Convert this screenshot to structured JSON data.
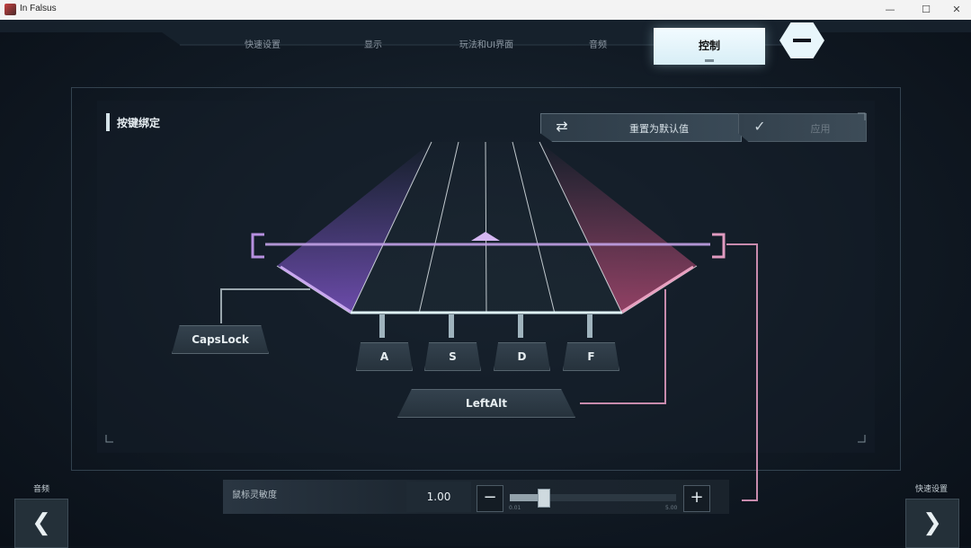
{
  "window": {
    "title": "In Falsus",
    "min": "—",
    "max": "☐",
    "close": "✕"
  },
  "tabs": [
    {
      "label": "快速设置"
    },
    {
      "label": "显示"
    },
    {
      "label": "玩法和UI界面"
    },
    {
      "label": "音频"
    },
    {
      "label": "控制",
      "active": true
    }
  ],
  "menu_button_icon": "minus-icon",
  "section": {
    "title": "按键绑定"
  },
  "actions": {
    "reset": {
      "label": "重置为默认值",
      "icon": "⇄"
    },
    "apply": {
      "label": "应用",
      "icon": "✓"
    }
  },
  "keys": {
    "left_side": "CapsLock",
    "lanes": [
      "A",
      "S",
      "D",
      "F"
    ],
    "bottom": "LeftAlt"
  },
  "sensitivity": {
    "label": "鼠标灵敏度",
    "value": "1.00",
    "min_label": "0.01",
    "max_label": "5.00",
    "level": 1.0,
    "minus": "−",
    "plus": "+"
  },
  "nav": {
    "prev": {
      "label": "音频",
      "arrow": "❮"
    },
    "next": {
      "label": "快速设置",
      "arrow": "❯"
    }
  },
  "colors": {
    "accent_purple": "#b27ee8",
    "accent_pink": "#d46a9a",
    "active_tab": "#eaf7fb"
  }
}
